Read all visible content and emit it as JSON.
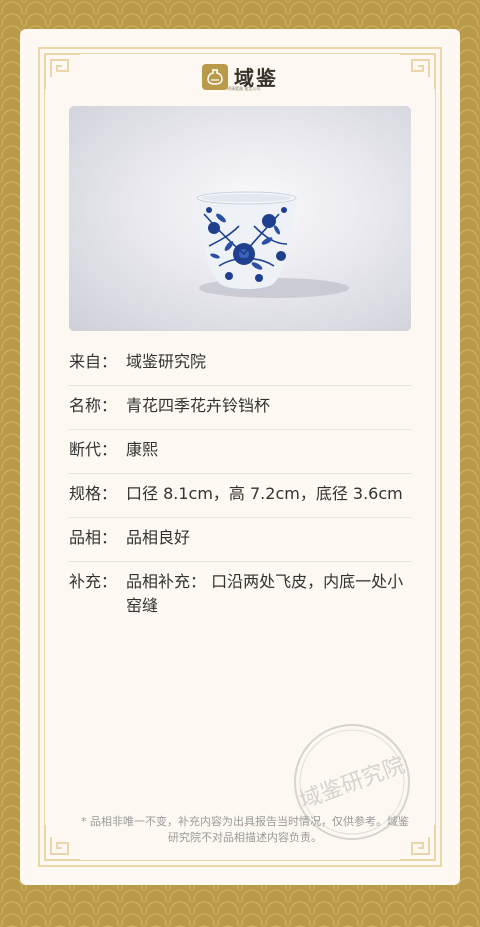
{
  "brand": {
    "name": "域鉴",
    "tagline": "明清瓷器 鉴定公司"
  },
  "item_image": {
    "alt": "青花四季花卉铃铛杯"
  },
  "details": [
    {
      "label": "来自：",
      "value": "域鉴研究院"
    },
    {
      "label": "名称：",
      "value": "青花四季花卉铃铛杯"
    },
    {
      "label": "断代：",
      "value": "康熙"
    },
    {
      "label": "规格：",
      "value": "口径 8.1cm，高 7.2cm，底径 3.6cm"
    },
    {
      "label": "品相：",
      "value": "品相良好"
    },
    {
      "label": "补充：",
      "value": "品相补充： 口沿两处飞皮，内底一处小窑缝"
    }
  ],
  "footnote": "* 品相非唯一不变，补充内容为出具报告当时情况，仅供参考。域鉴研究院不对品相描述内容负责。",
  "stamp": {
    "text": "域鉴研究院"
  },
  "colors": {
    "background_gold": "#b99a48",
    "card": "#fdf8f1",
    "frame_line": "#ecd5a8",
    "blue_porcelain": "#1f3f8f"
  }
}
